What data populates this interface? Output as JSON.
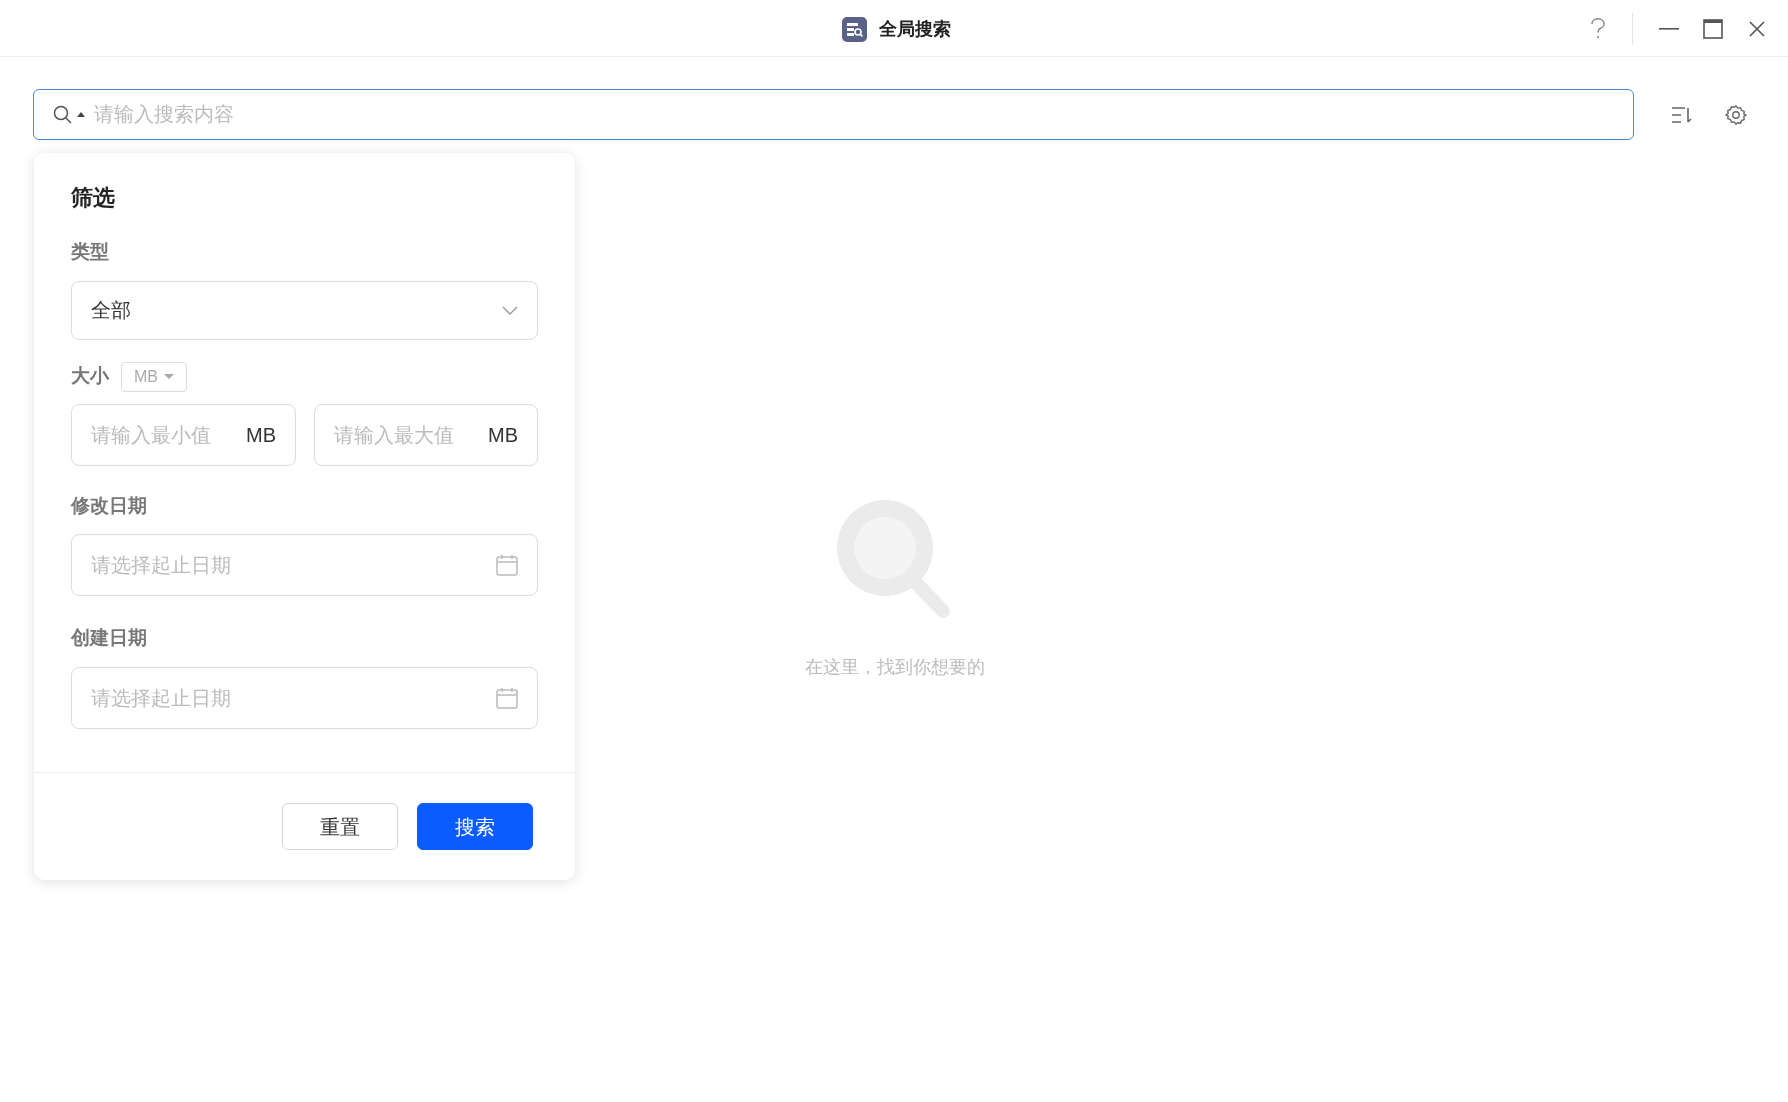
{
  "window": {
    "title": "全局搜索"
  },
  "search": {
    "placeholder": "请输入搜索内容"
  },
  "filter_panel": {
    "title": "筛选",
    "type": {
      "label": "类型",
      "value": "全部"
    },
    "size": {
      "label": "大小",
      "unit_dropdown": "MB",
      "min": {
        "placeholder": "请输入最小值",
        "unit": "MB"
      },
      "max": {
        "placeholder": "请输入最大值",
        "unit": "MB"
      }
    },
    "date_fields": [
      {
        "label": "修改日期",
        "placeholder": "请选择起止日期"
      },
      {
        "label": "创建日期",
        "placeholder": "请选择起止日期"
      }
    ],
    "buttons": [
      {
        "label": "重置",
        "kind": "secondary"
      },
      {
        "label": "搜索",
        "kind": "primary"
      }
    ]
  },
  "empty_state": {
    "text": "在这里，找到你想要的"
  }
}
